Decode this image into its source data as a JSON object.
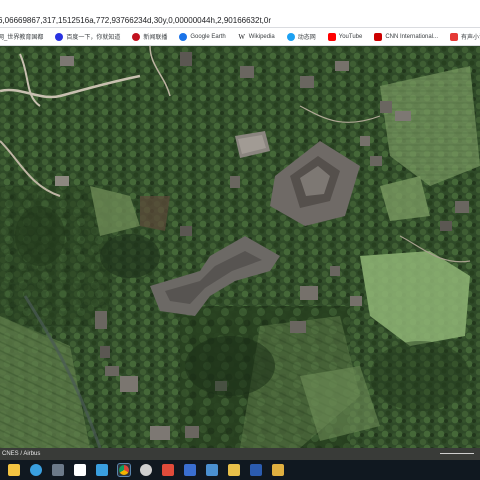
{
  "address_bar": {
    "url_visible": "6,06669867,317,1512516a,772,93766234d,30y,0,00000044h,2,90166632t,0r"
  },
  "bookmarks": [
    {
      "label": "网_世界教育国都",
      "icon": "globe-icon",
      "color": "#5f6368"
    },
    {
      "label": "百度一下，你就知道",
      "icon": "paw-icon",
      "color": "#2932e1"
    },
    {
      "label": "新闻联播",
      "icon": "cctv-icon",
      "color": "#c1121f"
    },
    {
      "label": "Google Earth",
      "icon": "google-earth-icon",
      "color": "#1a73e8"
    },
    {
      "label": "Wikipedia",
      "icon": "wikipedia-icon",
      "color": "#202124"
    },
    {
      "label": "动态网",
      "icon": "bird-icon",
      "color": "#1da1f2"
    },
    {
      "label": "YouTube",
      "icon": "youtube-icon",
      "color": "#ff0000"
    },
    {
      "label": "CNN International...",
      "icon": "cnn-icon",
      "color": "#cc0000"
    },
    {
      "label": "有声小说-有声读物...",
      "icon": "book-icon",
      "color": "#e53935"
    }
  ],
  "map": {
    "attribution": "CNES / Airbus"
  },
  "taskbar": {
    "apps": [
      {
        "name": "file-explorer-icon",
        "color": "#f4c542"
      },
      {
        "name": "edge-icon",
        "color": "#3aa0e0"
      },
      {
        "name": "calculator-icon",
        "color": "#6c7a89"
      },
      {
        "name": "document-icon",
        "color": "#ffffff"
      },
      {
        "name": "photos-icon",
        "color": "#3aa0e0"
      },
      {
        "name": "chrome-icon",
        "color": "#e8a13a"
      },
      {
        "name": "swirl-app-icon",
        "color": "#d0d0d0"
      },
      {
        "name": "media-player-icon",
        "color": "#e04b3a"
      },
      {
        "name": "browser-icon",
        "color": "#3a6fd0"
      },
      {
        "name": "mail-icon",
        "color": "#4a90d0"
      },
      {
        "name": "folder-icon",
        "color": "#e8c04a"
      },
      {
        "name": "word-icon",
        "color": "#2b5cb0"
      },
      {
        "name": "paint-icon",
        "color": "#e0b040"
      }
    ]
  }
}
